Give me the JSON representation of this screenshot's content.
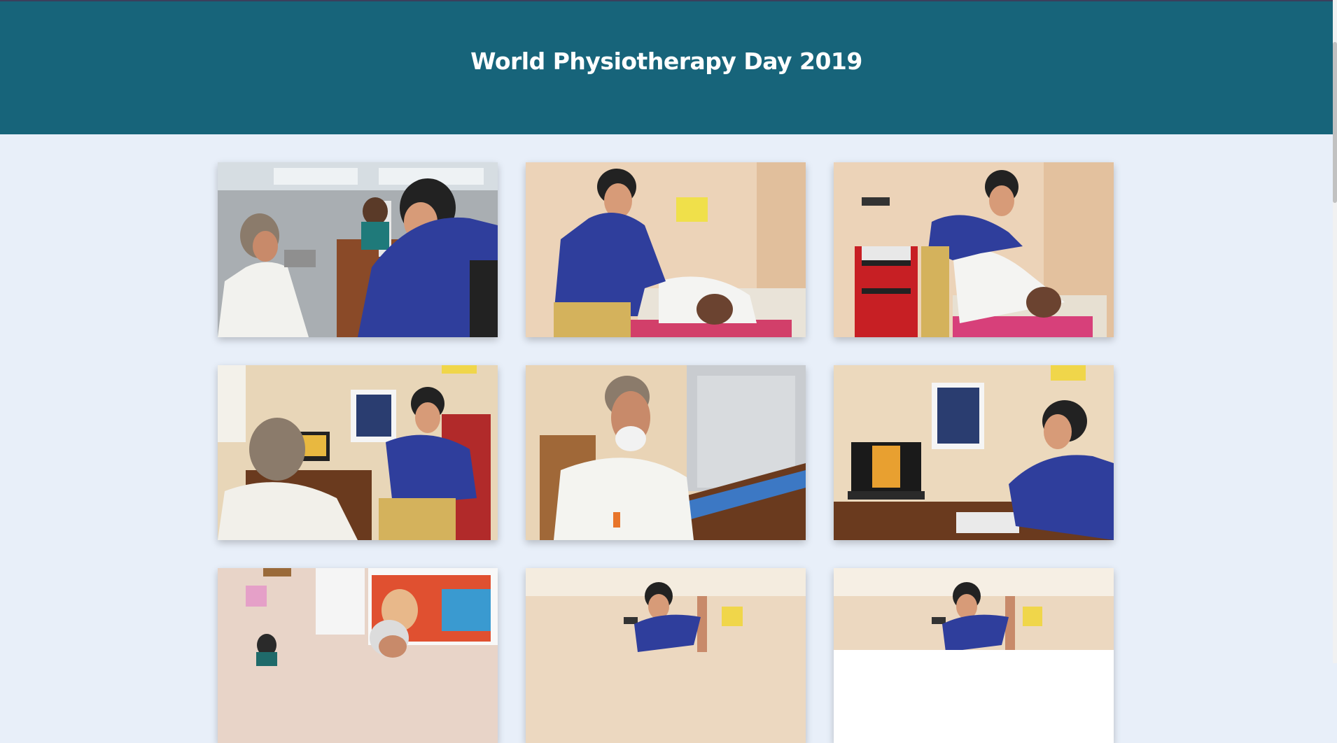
{
  "page": {
    "title": "World Physiotherapy Day 2019"
  },
  "gallery": {
    "photos": [
      {
        "id": 1,
        "scene": "bp-check"
      },
      {
        "id": 2,
        "scene": "treatment-bed"
      },
      {
        "id": 3,
        "scene": "knee-treatment"
      },
      {
        "id": 4,
        "scene": "consultation-desk"
      },
      {
        "id": 5,
        "scene": "patient-seated"
      },
      {
        "id": 6,
        "scene": "doctor-at-laptop"
      },
      {
        "id": 7,
        "scene": "poster-room"
      },
      {
        "id": 8,
        "scene": "leg-stretch"
      },
      {
        "id": 9,
        "scene": "leg-stretch-2"
      }
    ]
  },
  "colors": {
    "header_bg": "#17647a",
    "page_bg": "#e8eff9",
    "shirt_blue": "#2f3e9c"
  }
}
